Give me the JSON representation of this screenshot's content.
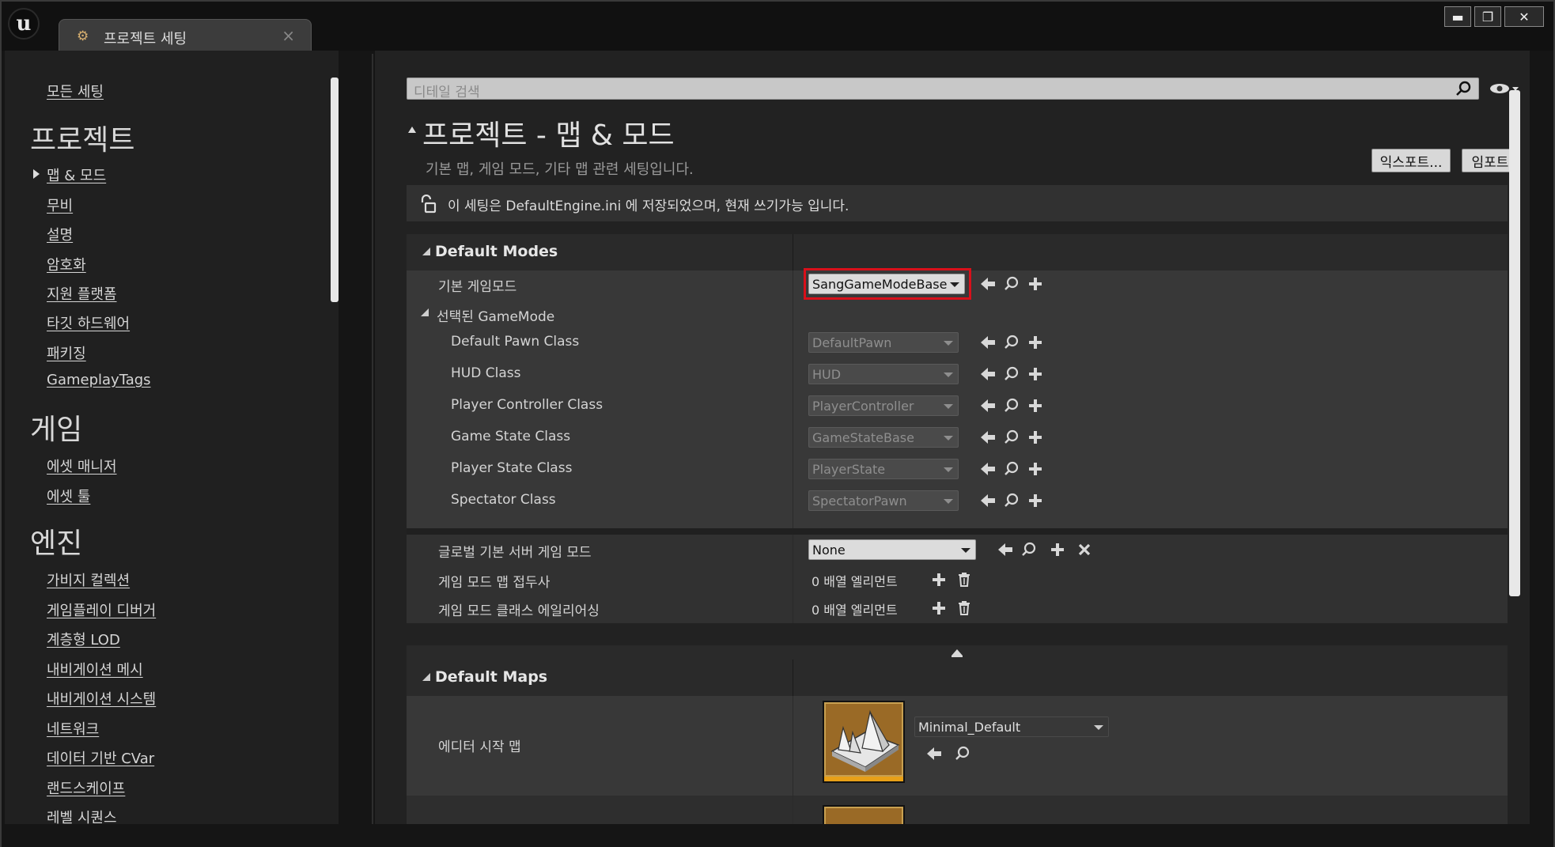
{
  "window": {
    "tab_title": "프로젝트 세팅",
    "tab_close": "×",
    "minimize": "▬",
    "maximize": "❐",
    "close": "✕"
  },
  "sidebar": {
    "all_settings": "모든 세팅",
    "sections": [
      {
        "heading": "프로젝트",
        "items": [
          "맵 & 모드",
          "무비",
          "설명",
          "암호화",
          "지원 플랫폼",
          "타깃 하드웨어",
          "패키징",
          "GameplayTags"
        ]
      },
      {
        "heading": "게임",
        "items": [
          "에셋 매니저",
          "에셋 툴"
        ]
      },
      {
        "heading": "엔진",
        "items": [
          "가비지 컬렉션",
          "게임플레이 디버거",
          "계층형 LOD",
          "내비게이션 메시",
          "내비게이션 시스템",
          "네트워크",
          "데이터 기반 CVar",
          "랜드스케이프",
          "레벨 시퀀스"
        ]
      }
    ]
  },
  "main": {
    "search_placeholder": "디테일 검색",
    "title": "프로젝트 - 맵 & 모드",
    "description": "기본 맵, 게임 모드, 기타 맵 관련 세팅입니다.",
    "export_label": "익스포트...",
    "import_label": "임포트",
    "notice": "이 세팅은 DefaultEngine.ini 에 저장되었으며, 현재 쓰기가능 입니다.",
    "default_modes": {
      "heading": "Default Modes",
      "default_gamemode_label": "기본 게임모드",
      "default_gamemode_value": "SangGameModeBase",
      "selected_gamemode_label": "선택된 GameMode",
      "classes": [
        {
          "label": "Default Pawn Class",
          "value": "DefaultPawn"
        },
        {
          "label": "HUD Class",
          "value": "HUD"
        },
        {
          "label": "Player Controller Class",
          "value": "PlayerController"
        },
        {
          "label": "Game State Class",
          "value": "GameStateBase"
        },
        {
          "label": "Player State Class",
          "value": "PlayerState"
        },
        {
          "label": "Spectator Class",
          "value": "SpectatorPawn"
        }
      ],
      "global_server_label": "글로벌 기본 서버 게임 모드",
      "global_server_value": "None",
      "map_prefix_label": "게임 모드 맵 접두사",
      "map_prefix_value": "0 배열 엘리먼트",
      "class_alias_label": "게임 모드 클래스 에일리어싱",
      "class_alias_value": "0 배열 엘리먼트"
    },
    "default_maps": {
      "heading": "Default Maps",
      "editor_startup_label": "에디터 시작 맵",
      "editor_startup_value": "Minimal_Default"
    }
  },
  "colors": {
    "highlight": "#d8101a",
    "thumbnail_accent": "#e8a018"
  }
}
